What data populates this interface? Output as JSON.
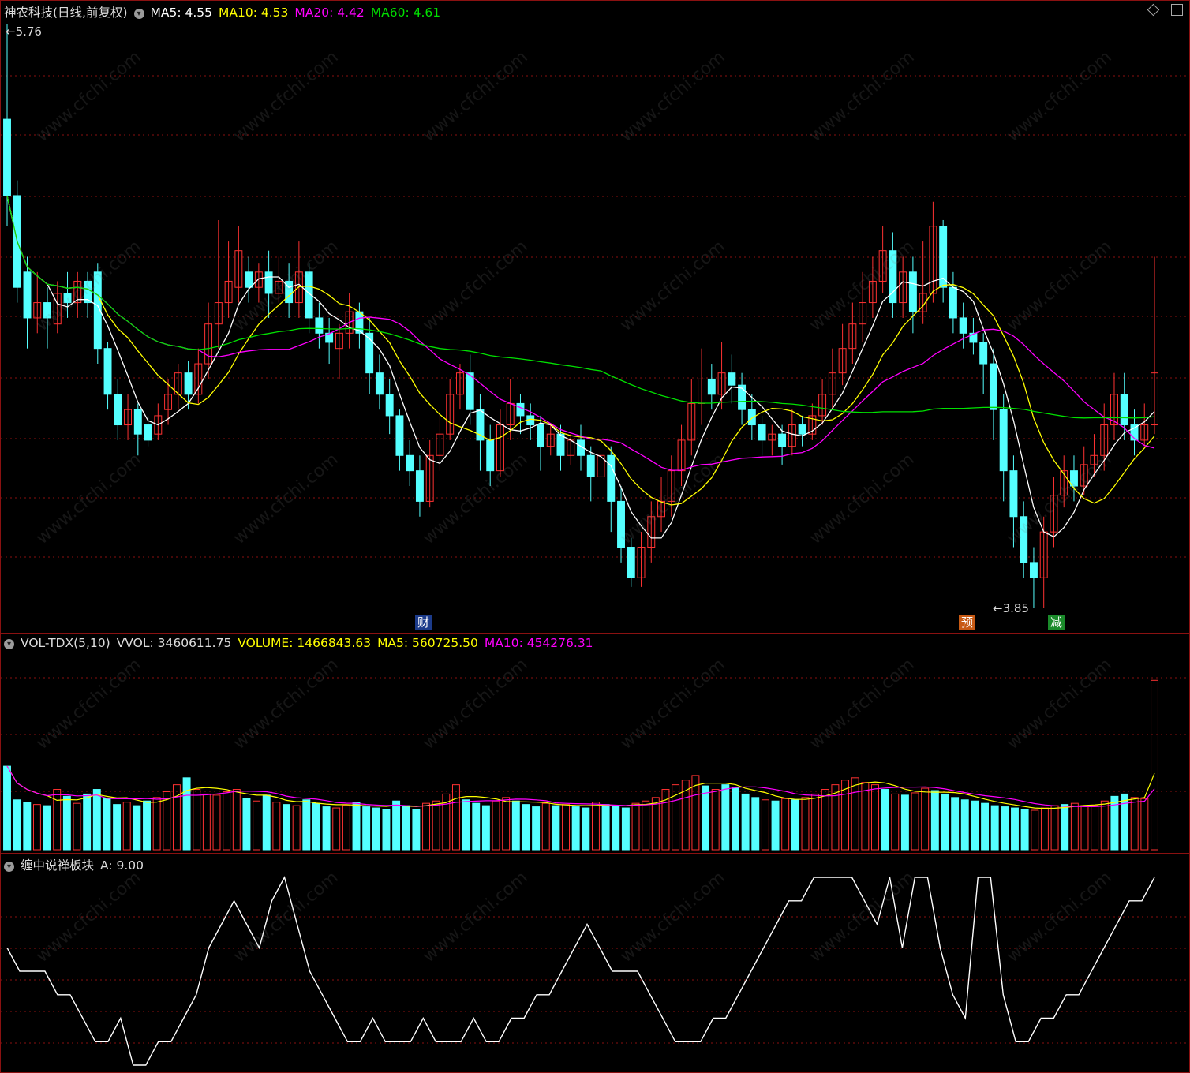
{
  "main_panel": {
    "stock_title": "神农科技(日线,前复权)",
    "indicators": [
      {
        "label": "MA5: 4.55",
        "color": "#ffffff"
      },
      {
        "label": "MA10: 4.53",
        "color": "#ffff00"
      },
      {
        "label": "MA20: 4.42",
        "color": "#ff00ff"
      },
      {
        "label": "MA60: 4.61",
        "color": "#00e000"
      }
    ],
    "high_label": "5.76",
    "low_label": "3.85",
    "tags": {
      "cai": "财",
      "yu": "预",
      "jian": "减"
    }
  },
  "volume_panel": {
    "name": "VOL-TDX(5,10)",
    "vvol": "VVOL: 3460611.75",
    "volume": "VOLUME: 1466843.63",
    "ma5": "MA5: 560725.50",
    "ma10": "MA10: 454276.31"
  },
  "indicator_panel": {
    "name": "缠中说禅板块",
    "value": "A: 9.00"
  },
  "watermark": "www.cfchi.com",
  "colors": {
    "up": "#ff3232",
    "down": "#54ffff",
    "ma5": "#ffffff",
    "ma10": "#ffff00",
    "ma20": "#ff00ff",
    "ma60": "#00e000",
    "grid": "#8a1111"
  },
  "chart_data": {
    "type": "candlestick",
    "price_range": [
      3.85,
      5.76
    ],
    "candles": [
      [
        5.45,
        5.2,
        5.76,
        5.1
      ],
      [
        5.2,
        4.9,
        5.25,
        4.85
      ],
      [
        4.95,
        4.8,
        5.0,
        4.7
      ],
      [
        4.8,
        4.85,
        4.95,
        4.75
      ],
      [
        4.85,
        4.8,
        4.9,
        4.7
      ],
      [
        4.78,
        4.88,
        4.92,
        4.75
      ],
      [
        4.88,
        4.85,
        4.95,
        4.8
      ],
      [
        4.85,
        4.92,
        4.95,
        4.8
      ],
      [
        4.92,
        4.85,
        4.95,
        4.8
      ],
      [
        4.95,
        4.7,
        4.98,
        4.65
      ],
      [
        4.7,
        4.55,
        4.72,
        4.5
      ],
      [
        4.55,
        4.45,
        4.6,
        4.4
      ],
      [
        4.45,
        4.5,
        4.55,
        4.4
      ],
      [
        4.5,
        4.42,
        4.52,
        4.35
      ],
      [
        4.45,
        4.4,
        4.48,
        4.38
      ],
      [
        4.42,
        4.48,
        4.52,
        4.4
      ],
      [
        4.5,
        4.55,
        4.6,
        4.45
      ],
      [
        4.55,
        4.62,
        4.65,
        4.5
      ],
      [
        4.62,
        4.55,
        4.66,
        4.5
      ],
      [
        4.55,
        4.65,
        4.7,
        4.52
      ],
      [
        4.65,
        4.78,
        4.85,
        4.6
      ],
      [
        4.78,
        4.85,
        5.12,
        4.7
      ],
      [
        4.85,
        4.92,
        5.05,
        4.8
      ],
      [
        4.9,
        5.02,
        5.1,
        4.85
      ],
      [
        4.95,
        4.9,
        5.0,
        4.85
      ],
      [
        4.9,
        4.95,
        4.98,
        4.85
      ],
      [
        4.95,
        4.88,
        5.02,
        4.8
      ],
      [
        4.88,
        4.92,
        5.0,
        4.85
      ],
      [
        4.92,
        4.85,
        4.98,
        4.8
      ],
      [
        4.85,
        4.95,
        5.05,
        4.8
      ],
      [
        4.95,
        4.8,
        4.98,
        4.75
      ],
      [
        4.8,
        4.75,
        4.85,
        4.7
      ],
      [
        4.75,
        4.72,
        4.8,
        4.65
      ],
      [
        4.7,
        4.75,
        4.78,
        4.6
      ],
      [
        4.75,
        4.82,
        4.88,
        4.7
      ],
      [
        4.82,
        4.75,
        4.85,
        4.7
      ],
      [
        4.75,
        4.62,
        4.8,
        4.55
      ],
      [
        4.62,
        4.55,
        4.68,
        4.5
      ],
      [
        4.55,
        4.48,
        4.6,
        4.42
      ],
      [
        4.48,
        4.35,
        4.5,
        4.3
      ],
      [
        4.35,
        4.3,
        4.4,
        4.25
      ],
      [
        4.3,
        4.2,
        4.35,
        4.15
      ],
      [
        4.2,
        4.35,
        4.4,
        4.18
      ],
      [
        4.35,
        4.42,
        4.5,
        4.3
      ],
      [
        4.42,
        4.55,
        4.6,
        4.4
      ],
      [
        4.55,
        4.62,
        4.65,
        4.5
      ],
      [
        4.62,
        4.5,
        4.68,
        4.45
      ],
      [
        4.5,
        4.4,
        4.55,
        4.3
      ],
      [
        4.4,
        4.3,
        4.45,
        4.25
      ],
      [
        4.3,
        4.45,
        4.5,
        4.28
      ],
      [
        4.45,
        4.52,
        4.6,
        4.4
      ],
      [
        4.52,
        4.48,
        4.55,
        4.42
      ],
      [
        4.48,
        4.45,
        4.52,
        4.4
      ],
      [
        4.45,
        4.38,
        4.48,
        4.3
      ],
      [
        4.38,
        4.42,
        4.45,
        4.35
      ],
      [
        4.42,
        4.35,
        4.45,
        4.3
      ],
      [
        4.35,
        4.4,
        4.42,
        4.32
      ],
      [
        4.4,
        4.35,
        4.45,
        4.3
      ],
      [
        4.35,
        4.28,
        4.38,
        4.2
      ],
      [
        4.28,
        4.35,
        4.4,
        4.25
      ],
      [
        4.35,
        4.2,
        4.38,
        4.1
      ],
      [
        4.2,
        4.05,
        4.25,
        4.0
      ],
      [
        4.05,
        3.95,
        4.08,
        3.92
      ],
      [
        3.95,
        4.05,
        4.1,
        3.92
      ],
      [
        4.05,
        4.15,
        4.2,
        4.0
      ],
      [
        4.15,
        4.2,
        4.28,
        4.1
      ],
      [
        4.2,
        4.3,
        4.35,
        4.15
      ],
      [
        4.3,
        4.4,
        4.45,
        4.25
      ],
      [
        4.4,
        4.52,
        4.6,
        4.35
      ],
      [
        4.52,
        4.6,
        4.7,
        4.45
      ],
      [
        4.6,
        4.55,
        4.65,
        4.5
      ],
      [
        4.55,
        4.62,
        4.72,
        4.5
      ],
      [
        4.62,
        4.58,
        4.68,
        4.52
      ],
      [
        4.58,
        4.5,
        4.62,
        4.45
      ],
      [
        4.5,
        4.45,
        4.55,
        4.4
      ],
      [
        4.45,
        4.4,
        4.48,
        4.35
      ],
      [
        4.4,
        4.42,
        4.45,
        4.35
      ],
      [
        4.42,
        4.38,
        4.45,
        4.32
      ],
      [
        4.38,
        4.45,
        4.5,
        4.35
      ],
      [
        4.45,
        4.42,
        4.48,
        4.38
      ],
      [
        4.42,
        4.48,
        4.52,
        4.4
      ],
      [
        4.48,
        4.55,
        4.6,
        4.45
      ],
      [
        4.55,
        4.62,
        4.7,
        4.5
      ],
      [
        4.62,
        4.7,
        4.78,
        4.58
      ],
      [
        4.7,
        4.78,
        4.85,
        4.65
      ],
      [
        4.78,
        4.85,
        4.95,
        4.72
      ],
      [
        4.85,
        4.92,
        5.0,
        4.8
      ],
      [
        4.92,
        5.02,
        5.1,
        4.88
      ],
      [
        5.02,
        4.85,
        5.08,
        4.8
      ],
      [
        4.85,
        4.95,
        5.0,
        4.8
      ],
      [
        4.95,
        4.82,
        5.0,
        4.75
      ],
      [
        4.82,
        4.88,
        5.05,
        4.78
      ],
      [
        4.88,
        5.1,
        5.18,
        4.85
      ],
      [
        5.1,
        4.9,
        5.12,
        4.85
      ],
      [
        4.9,
        4.8,
        4.95,
        4.75
      ],
      [
        4.8,
        4.75,
        4.85,
        4.7
      ],
      [
        4.75,
        4.72,
        4.8,
        4.68
      ],
      [
        4.72,
        4.65,
        4.75,
        4.55
      ],
      [
        4.65,
        4.5,
        4.7,
        4.4
      ],
      [
        4.5,
        4.3,
        4.55,
        4.2
      ],
      [
        4.3,
        4.15,
        4.35,
        4.05
      ],
      [
        4.15,
        4.0,
        4.2,
        3.95
      ],
      [
        4.0,
        3.95,
        4.05,
        3.85
      ],
      [
        3.95,
        4.1,
        4.15,
        3.85
      ],
      [
        4.1,
        4.22,
        4.28,
        4.05
      ],
      [
        4.22,
        4.3,
        4.35,
        4.18
      ],
      [
        4.3,
        4.25,
        4.35,
        4.2
      ],
      [
        4.25,
        4.32,
        4.38,
        4.22
      ],
      [
        4.32,
        4.35,
        4.42,
        4.28
      ],
      [
        4.35,
        4.45,
        4.52,
        4.3
      ],
      [
        4.45,
        4.55,
        4.62,
        4.4
      ],
      [
        4.55,
        4.45,
        4.62,
        4.4
      ],
      [
        4.45,
        4.4,
        4.5,
        4.35
      ],
      [
        4.4,
        4.45,
        4.52,
        4.38
      ],
      [
        4.45,
        4.62,
        5.0,
        4.42
      ]
    ],
    "volume": [
      720,
      430,
      410,
      390,
      380,
      520,
      460,
      400,
      480,
      520,
      440,
      390,
      410,
      380,
      420,
      450,
      500,
      560,
      620,
      520,
      480,
      470,
      500,
      520,
      440,
      420,
      470,
      410,
      390,
      380,
      430,
      400,
      370,
      360,
      380,
      410,
      370,
      360,
      350,
      420,
      380,
      350,
      400,
      420,
      480,
      560,
      430,
      400,
      380,
      420,
      450,
      420,
      390,
      370,
      400,
      380,
      390,
      370,
      360,
      410,
      390,
      380,
      360,
      400,
      420,
      450,
      520,
      560,
      600,
      640,
      550,
      520,
      560,
      540,
      480,
      450,
      430,
      420,
      440,
      430,
      450,
      480,
      520,
      560,
      600,
      620,
      580,
      560,
      520,
      480,
      470,
      490,
      530,
      510,
      480,
      450,
      430,
      420,
      400,
      380,
      370,
      360,
      350,
      340,
      360,
      380,
      390,
      400,
      380,
      380,
      420,
      460,
      480,
      450,
      440,
      1460
    ],
    "indicator": [
      6,
      5,
      5,
      5,
      4,
      4,
      3,
      2,
      2,
      3,
      1,
      1,
      2,
      2,
      3,
      4,
      6,
      7,
      8,
      7,
      6,
      8,
      9,
      7,
      5,
      4,
      3,
      2,
      2,
      3,
      2,
      2,
      2,
      3,
      2,
      2,
      2,
      3,
      2,
      2,
      3,
      3,
      4,
      4,
      5,
      6,
      7,
      6,
      5,
      5,
      5,
      4,
      3,
      2,
      2,
      2,
      3,
      3,
      4,
      5,
      6,
      7,
      8,
      8,
      9,
      9,
      9,
      9,
      8,
      7,
      9,
      6,
      9,
      9,
      6,
      4,
      3,
      9,
      9,
      4,
      2,
      2,
      3,
      3,
      4,
      4,
      5,
      6,
      7,
      8,
      8,
      9
    ],
    "ma_values": {
      "MA5": 4.55,
      "MA10": 4.53,
      "MA20": 4.42,
      "MA60": 4.61
    }
  }
}
